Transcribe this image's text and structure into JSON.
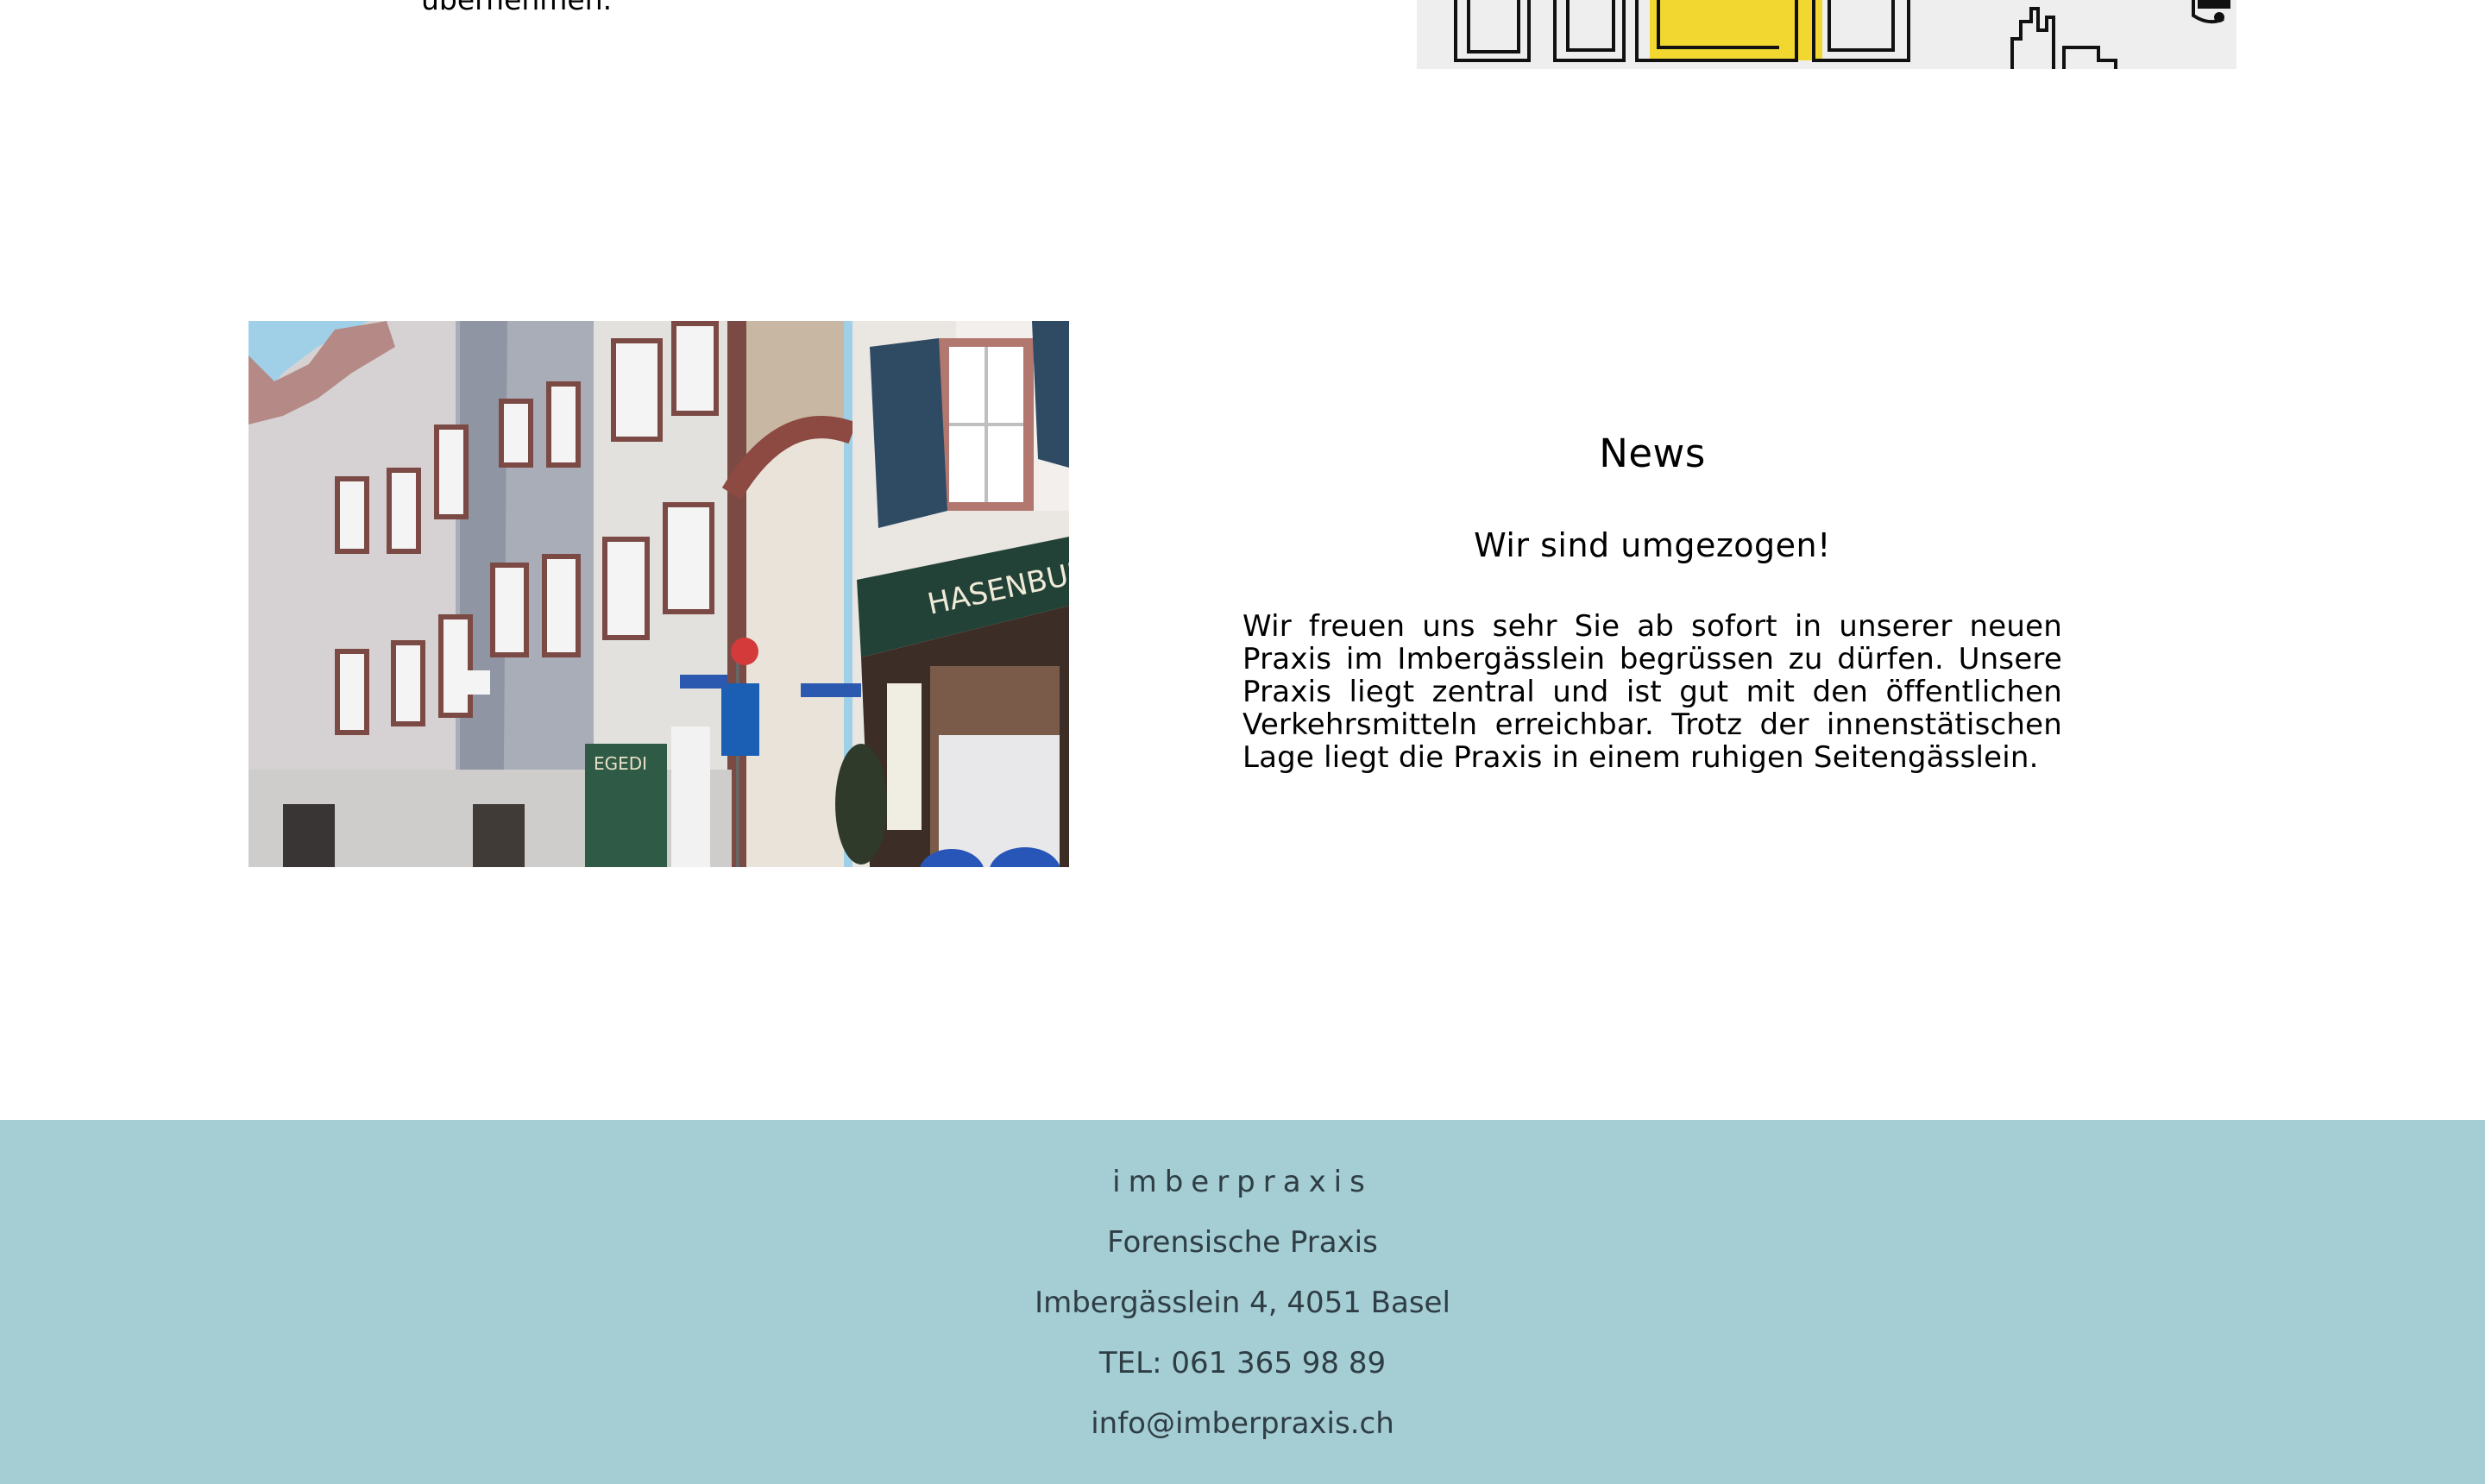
{
  "top_section": {
    "text_fragment": "übernehmen."
  },
  "news": {
    "heading": "News",
    "subheading": "Wir sind umgezogen!",
    "body": "Wir freuen uns sehr Sie ab sofort in unserer neuen Praxis im Imbergässlein begrüssen zu dürfen. Unsere Praxis liegt zentral und ist gut mit den öffentlichen Verkehrsmitteln erreichbar. Trotz der innenstätischen Lage liegt die Praxis in einem ruhigen Seitengässlein.",
    "photo_signs": {
      "shop_sign": "HASENBUR",
      "store_sign": "EGEDI"
    }
  },
  "footer": {
    "brand": "imberpraxis",
    "subtitle": "Forensische Praxis",
    "address": "Imbergässlein 4, 4051 Basel",
    "phone": "TEL: 061 365 98 89",
    "email": "info@imberpraxis.ch"
  },
  "colors": {
    "footer_background": "#a4cdd4",
    "footer_text": "#2f3d44",
    "accent_yellow": "#f2d730"
  }
}
